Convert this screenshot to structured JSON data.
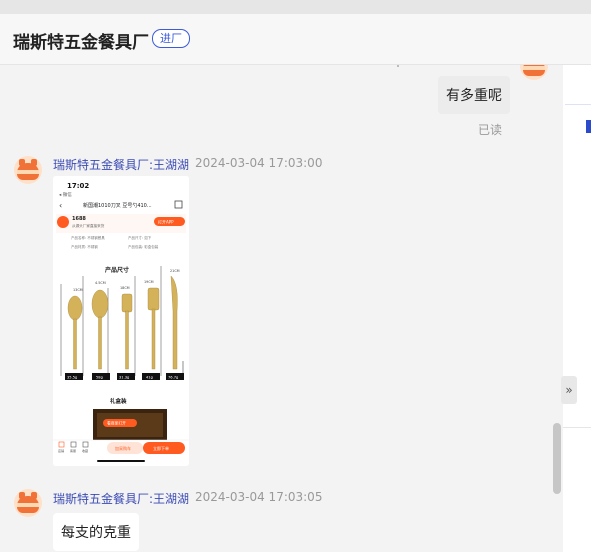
{
  "header": {
    "shop_name": "瑞斯特五金餐具厂",
    "enter_label": "进厂"
  },
  "messages": [
    {
      "type": "text",
      "side": "right",
      "text": "有多重呢",
      "status": "已读"
    },
    {
      "type": "image",
      "side": "left",
      "sender": "瑞斯特五金餐具厂:王湖湖",
      "time": "2024-03-04 17:03:00"
    },
    {
      "type": "text",
      "side": "left",
      "sender": "瑞斯特五金餐具厂:王湖湖",
      "time": "2024-03-04 17:03:05",
      "text": "每支的克重"
    }
  ],
  "screenshot": {
    "status_time": "17:02",
    "status_sub": "◂ 微信",
    "title": "新国潮1010刀叉 豆号勺410...",
    "brand": "1688",
    "brand_sub": "从源头厂家直接采货",
    "open_app": "打开APP",
    "spec_rows": [
      [
        "产品名称: 不锈钢餐具",
        "产品尺寸: 如下"
      ],
      [
        "产品材质: 不锈钢",
        "产品包装: 彩盒包装"
      ]
    ],
    "size_title": "产品尺寸",
    "sizes": [
      "13CM",
      "4.5CM",
      "18CM",
      "19CM",
      "21CM"
    ],
    "weights": [
      "35.5g",
      "58g",
      "31.3g",
      "41g",
      "76.7g"
    ],
    "gift_title": "礼盒装",
    "float_label": "看商家打开",
    "nav": [
      "店铺",
      "客服",
      "收藏"
    ],
    "cart_btn": "加采购车",
    "buy_btn": "立即下单"
  },
  "colors": {
    "accent": "#3b5bdb",
    "sender": "#3b4bb5",
    "orange": "#ff5a1f",
    "gold": "#d4b25a"
  }
}
